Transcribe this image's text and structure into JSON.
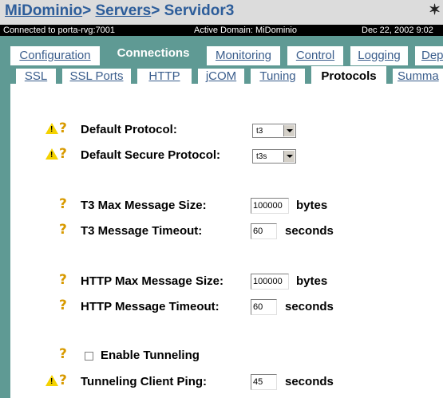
{
  "header": {
    "crumb_domain": "MiDominio",
    "crumb_sep1": ">",
    "crumb_servers": "Servers",
    "crumb_sep2": ">",
    "crumb_server": "Servidor3",
    "corner_glyph": "✶"
  },
  "status": {
    "connection": "Connected to porta-rvg:7001",
    "active_domain": "Active Domain: MiDominio",
    "date": "Dec 22, 2002 9:02"
  },
  "tabs": [
    "Configuration",
    "Connections",
    "Monitoring",
    "Control",
    "Logging",
    "Dep"
  ],
  "subtabs": [
    "SSL",
    "SSL Ports",
    "HTTP",
    "jCOM",
    "Tuning",
    "Protocols",
    "Summa"
  ],
  "form": {
    "default_protocol_label": "Default Protocol:",
    "default_protocol_value": "t3",
    "default_secure_label": "Default Secure Protocol:",
    "default_secure_value": "t3s",
    "t3_max_label": "T3 Max Message Size:",
    "t3_max_value": "100000",
    "t3_max_unit": "bytes",
    "t3_timeout_label": "T3 Message Timeout:",
    "t3_timeout_value": "60",
    "t3_timeout_unit": "seconds",
    "http_max_label": "HTTP Max Message Size:",
    "http_max_value": "100000",
    "http_max_unit": "bytes",
    "http_timeout_label": "HTTP Message Timeout:",
    "http_timeout_value": "60",
    "http_timeout_unit": "seconds",
    "tunneling_label": "Enable Tunneling",
    "tunneling_checked": false,
    "ping_label": "Tunneling Client Ping:",
    "ping_value": "45",
    "ping_unit": "seconds"
  },
  "icons": {
    "help": "?",
    "warning": "!"
  },
  "colors": {
    "teal": "#5f9a94",
    "link": "#3a5d8c",
    "help": "#d89a00",
    "warning": "#f4d200"
  }
}
